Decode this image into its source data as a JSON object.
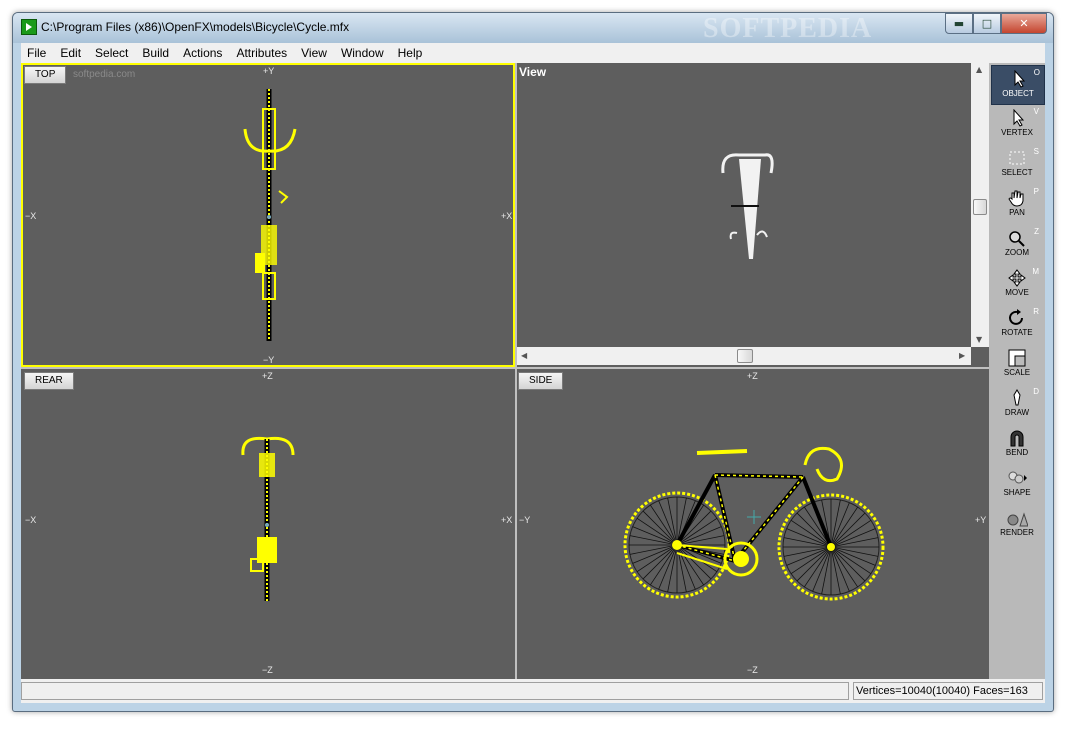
{
  "window": {
    "title": "C:\\Program Files (x86)\\OpenFX\\models\\Bicycle\\Cycle.mfx",
    "watermark": "SOFTPEDIA",
    "minimize_glyph": "▬",
    "maximize_glyph": "□",
    "close_glyph": "✕"
  },
  "menu": [
    "File",
    "Edit",
    "Select",
    "Build",
    "Actions",
    "Attributes",
    "View",
    "Window",
    "Help"
  ],
  "viewports": {
    "top": {
      "label": "TOP",
      "axis_top": "+Y",
      "axis_bottom": "−Y",
      "axis_left": "−X",
      "axis_right": "+X",
      "watermark": "softpedia.com"
    },
    "view": {
      "title": "View"
    },
    "rear": {
      "label": "REAR",
      "axis_top": "+Z",
      "axis_bottom": "−Z",
      "axis_left": "−X",
      "axis_right": "+X"
    },
    "side": {
      "label": "SIDE",
      "axis_top": "+Z",
      "axis_bottom": "−Z",
      "axis_left": "−Y",
      "axis_right": "+Y"
    }
  },
  "tools": [
    {
      "label": "OBJECT",
      "key": "O",
      "icon": "arrow-cursor-icon",
      "active": true
    },
    {
      "label": "VERTEX",
      "key": "V",
      "icon": "vertex-cursor-icon",
      "active": false
    },
    {
      "label": "SELECT",
      "key": "S",
      "icon": "select-box-icon",
      "active": false
    },
    {
      "label": "PAN",
      "key": "P",
      "icon": "hand-icon",
      "active": false
    },
    {
      "label": "ZOOM",
      "key": "Z",
      "icon": "magnifier-icon",
      "active": false
    },
    {
      "label": "MOVE",
      "key": "M",
      "icon": "move-arrows-icon",
      "active": false
    },
    {
      "label": "ROTATE",
      "key": "R",
      "icon": "rotate-icon",
      "active": false
    },
    {
      "label": "SCALE",
      "key": "",
      "icon": "scale-icon",
      "active": false
    },
    {
      "label": "DRAW",
      "key": "D",
      "icon": "pen-icon",
      "active": false
    },
    {
      "label": "BEND",
      "key": "",
      "icon": "magnet-icon",
      "active": false
    },
    {
      "label": "SHAPE",
      "key": "",
      "icon": "shapes-icon",
      "active": false
    },
    {
      "label": "RENDER",
      "key": "",
      "icon": "render-icon",
      "active": false
    }
  ],
  "status": {
    "left": "",
    "right": "Vertices=10040(10040) Faces=163"
  },
  "colors": {
    "wire": "#ffff00",
    "frame": "#000000",
    "viewport_bg": "#5e5e5e",
    "active_border": "#ffff00",
    "toolbar_active": "#3a4d66"
  }
}
